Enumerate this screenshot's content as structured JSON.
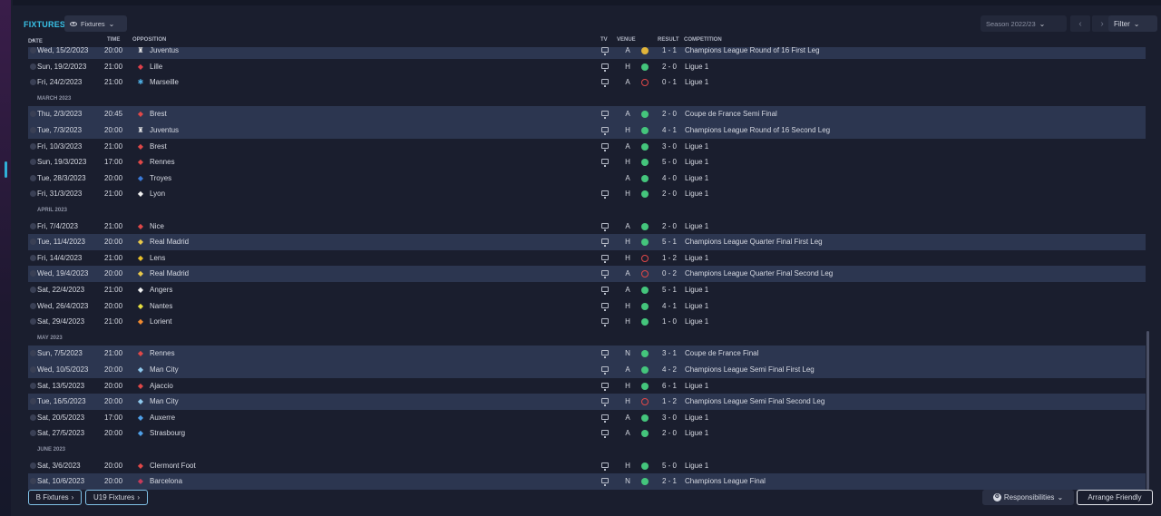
{
  "header": {
    "title": "FIXTURES",
    "view_dropdown": "Fixtures",
    "season": "Season 2022/23",
    "filter": "Filter"
  },
  "columns": {
    "date": "DATE",
    "time": "TIME",
    "opposition": "OPPOSITION",
    "tv": "TV",
    "venue": "VENUE",
    "result": "RESULT",
    "competition": "COMPETITION"
  },
  "rows": [
    {
      "type": "match",
      "date": "Wed, 15/2/2023",
      "time": "20:00",
      "opp": "Juventus",
      "badge": "♜",
      "badge_color": "#e8e8e8",
      "tv": true,
      "venue": "A",
      "result": "draw",
      "score": "1 - 1",
      "comp": "Champions League Round of 16 First Leg",
      "style": "hl"
    },
    {
      "type": "match",
      "date": "Sun, 19/2/2023",
      "time": "21:00",
      "opp": "Lille",
      "badge": "◆",
      "badge_color": "#e0404a",
      "tv": true,
      "venue": "H",
      "result": "win",
      "score": "2 - 0",
      "comp": "Ligue 1",
      "style": ""
    },
    {
      "type": "match",
      "date": "Fri, 24/2/2023",
      "time": "21:00",
      "opp": "Marseille",
      "badge": "✱",
      "badge_color": "#4fb2e8",
      "tv": true,
      "venue": "A",
      "result": "loss",
      "score": "0 - 1",
      "comp": "Ligue 1",
      "style": ""
    },
    {
      "type": "month",
      "label": "MARCH 2023"
    },
    {
      "type": "match",
      "date": "Thu, 2/3/2023",
      "time": "20:45",
      "opp": "Brest",
      "badge": "◆",
      "badge_color": "#e04848",
      "tv": true,
      "venue": "A",
      "result": "win",
      "score": "2 - 0",
      "comp": "Coupe de France Semi Final",
      "style": "hl"
    },
    {
      "type": "match",
      "date": "Tue, 7/3/2023",
      "time": "20:00",
      "opp": "Juventus",
      "badge": "♜",
      "badge_color": "#e8e8e8",
      "tv": true,
      "venue": "H",
      "result": "win",
      "score": "4 - 1",
      "comp": "Champions League Round of 16 Second Leg",
      "style": "hl"
    },
    {
      "type": "match",
      "date": "Fri, 10/3/2023",
      "time": "21:00",
      "opp": "Brest",
      "badge": "◆",
      "badge_color": "#e04848",
      "tv": true,
      "venue": "A",
      "result": "win",
      "score": "3 - 0",
      "comp": "Ligue 1",
      "style": ""
    },
    {
      "type": "match",
      "date": "Sun, 19/3/2023",
      "time": "17:00",
      "opp": "Rennes",
      "badge": "◆",
      "badge_color": "#e04848",
      "tv": true,
      "venue": "H",
      "result": "win",
      "score": "5 - 0",
      "comp": "Ligue 1",
      "style": ""
    },
    {
      "type": "match",
      "date": "Tue, 28/3/2023",
      "time": "20:00",
      "opp": "Troyes",
      "badge": "◆",
      "badge_color": "#3a7ad8",
      "tv": false,
      "venue": "A",
      "result": "win",
      "score": "4 - 0",
      "comp": "Ligue 1",
      "style": ""
    },
    {
      "type": "match",
      "date": "Fri, 31/3/2023",
      "time": "21:00",
      "opp": "Lyon",
      "badge": "◆",
      "badge_color": "#f0f0f0",
      "tv": true,
      "venue": "H",
      "result": "win",
      "score": "2 - 0",
      "comp": "Ligue 1",
      "style": ""
    },
    {
      "type": "month",
      "label": "APRIL 2023"
    },
    {
      "type": "match",
      "date": "Fri, 7/4/2023",
      "time": "21:00",
      "opp": "Nice",
      "badge": "◆",
      "badge_color": "#e04848",
      "tv": true,
      "venue": "A",
      "result": "win",
      "score": "2 - 0",
      "comp": "Ligue 1",
      "style": ""
    },
    {
      "type": "match",
      "date": "Tue, 11/4/2023",
      "time": "20:00",
      "opp": "Real Madrid",
      "badge": "◆",
      "badge_color": "#e8c84a",
      "tv": true,
      "venue": "H",
      "result": "win",
      "score": "5 - 1",
      "comp": "Champions League Quarter Final First Leg",
      "style": "hl"
    },
    {
      "type": "match",
      "date": "Fri, 14/4/2023",
      "time": "21:00",
      "opp": "Lens",
      "badge": "◆",
      "badge_color": "#e8c02a",
      "tv": true,
      "venue": "H",
      "result": "loss",
      "score": "1 - 2",
      "comp": "Ligue 1",
      "style": ""
    },
    {
      "type": "match",
      "date": "Wed, 19/4/2023",
      "time": "20:00",
      "opp": "Real Madrid",
      "badge": "◆",
      "badge_color": "#e8c84a",
      "tv": true,
      "venue": "A",
      "result": "loss",
      "score": "0 - 2",
      "comp": "Champions League Quarter Final Second Leg",
      "style": "hl"
    },
    {
      "type": "match",
      "date": "Sat, 22/4/2023",
      "time": "21:00",
      "opp": "Angers",
      "badge": "◆",
      "badge_color": "#f0f0f0",
      "tv": true,
      "venue": "A",
      "result": "win",
      "score": "5 - 1",
      "comp": "Ligue 1",
      "style": ""
    },
    {
      "type": "match",
      "date": "Wed, 26/4/2023",
      "time": "20:00",
      "opp": "Nantes",
      "badge": "◆",
      "badge_color": "#e8e040",
      "tv": true,
      "venue": "H",
      "result": "win",
      "score": "4 - 1",
      "comp": "Ligue 1",
      "style": ""
    },
    {
      "type": "match",
      "date": "Sat, 29/4/2023",
      "time": "21:00",
      "opp": "Lorient",
      "badge": "◆",
      "badge_color": "#f08a30",
      "tv": true,
      "venue": "H",
      "result": "win",
      "score": "1 - 0",
      "comp": "Ligue 1",
      "style": ""
    },
    {
      "type": "month",
      "label": "MAY 2023"
    },
    {
      "type": "match",
      "date": "Sun, 7/5/2023",
      "time": "21:00",
      "opp": "Rennes",
      "badge": "◆",
      "badge_color": "#e04848",
      "tv": true,
      "venue": "N",
      "result": "win",
      "score": "3 - 1",
      "comp": "Coupe de France Final",
      "style": "hl"
    },
    {
      "type": "match",
      "date": "Wed, 10/5/2023",
      "time": "20:00",
      "opp": "Man City",
      "badge": "◆",
      "badge_color": "#8fc8ec",
      "tv": true,
      "venue": "A",
      "result": "win",
      "score": "4 - 2",
      "comp": "Champions League Semi Final First Leg",
      "style": "hl"
    },
    {
      "type": "match",
      "date": "Sat, 13/5/2023",
      "time": "20:00",
      "opp": "Ajaccio",
      "badge": "◆",
      "badge_color": "#e04848",
      "tv": true,
      "venue": "H",
      "result": "win",
      "score": "6 - 1",
      "comp": "Ligue 1",
      "style": ""
    },
    {
      "type": "match",
      "date": "Tue, 16/5/2023",
      "time": "20:00",
      "opp": "Man City",
      "badge": "◆",
      "badge_color": "#8fc8ec",
      "tv": true,
      "venue": "H",
      "result": "loss",
      "score": "1 - 2",
      "comp": "Champions League Semi Final Second Leg",
      "style": "hl"
    },
    {
      "type": "match",
      "date": "Sat, 20/5/2023",
      "time": "17:00",
      "opp": "Auxerre",
      "badge": "◆",
      "badge_color": "#4fa0e8",
      "tv": true,
      "venue": "A",
      "result": "win",
      "score": "3 - 0",
      "comp": "Ligue 1",
      "style": ""
    },
    {
      "type": "match",
      "date": "Sat, 27/5/2023",
      "time": "20:00",
      "opp": "Strasbourg",
      "badge": "◆",
      "badge_color": "#4fa0e8",
      "tv": true,
      "venue": "A",
      "result": "win",
      "score": "2 - 0",
      "comp": "Ligue 1",
      "style": ""
    },
    {
      "type": "month",
      "label": "JUNE 2023"
    },
    {
      "type": "match",
      "date": "Sat, 3/6/2023",
      "time": "20:00",
      "opp": "Clermont Foot",
      "badge": "◆",
      "badge_color": "#e04848",
      "tv": true,
      "venue": "H",
      "result": "win",
      "score": "5 - 0",
      "comp": "Ligue 1",
      "style": ""
    },
    {
      "type": "match",
      "date": "Sat, 10/6/2023",
      "time": "20:00",
      "opp": "Barcelona",
      "badge": "◆",
      "badge_color": "#c83a5a",
      "tv": true,
      "venue": "N",
      "result": "win",
      "score": "2 - 1",
      "comp": "Champions League Final",
      "style": "hl"
    }
  ],
  "footer": {
    "b_fixtures": "B Fixtures",
    "u19_fixtures": "U19 Fixtures",
    "responsibilities": "Responsibilities",
    "arrange_friendly": "Arrange Friendly"
  },
  "colors": {
    "accent": "#39c1e6",
    "win": "#44c57c",
    "loss": "#e04848",
    "draw": "#e0b43a"
  }
}
